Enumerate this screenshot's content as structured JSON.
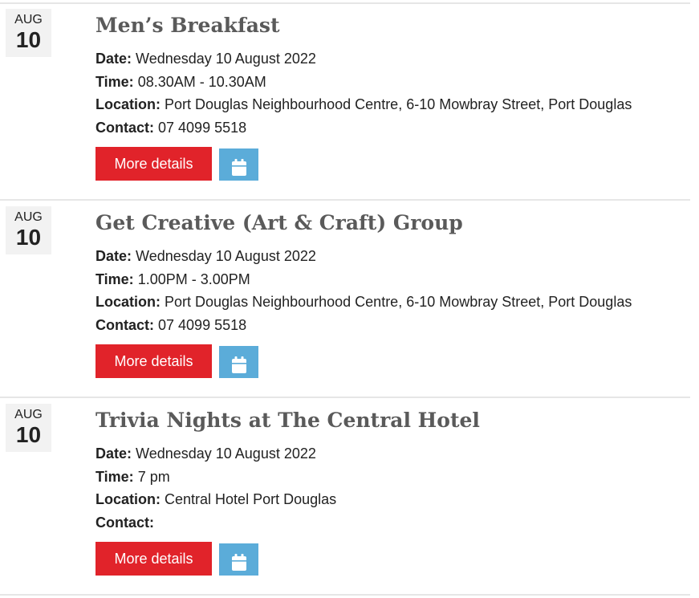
{
  "events": [
    {
      "month": "AUG",
      "day": "10",
      "title": "Men’s Breakfast",
      "date_label": "Date:",
      "date": "Wednesday 10 August 2022",
      "time_label": "Time:",
      "time": "08.30AM - 10.30AM",
      "location_label": "Location:",
      "location": "Port Douglas Neighbourhood Centre, 6-10 Mowbray Street, Port Douglas",
      "contact_label": "Contact:",
      "contact": "07 4099 5518",
      "more_label": "More details",
      "calendar_icon": "calendar-icon"
    },
    {
      "month": "AUG",
      "day": "10",
      "title": "Get Creative (Art & Craft) Group",
      "date_label": "Date:",
      "date": "Wednesday 10 August 2022",
      "time_label": "Time:",
      "time": "1.00PM - 3.00PM",
      "location_label": "Location:",
      "location": "Port Douglas Neighbourhood Centre, 6-10 Mowbray Street, Port Douglas",
      "contact_label": "Contact:",
      "contact": "07 4099 5518",
      "more_label": "More details",
      "calendar_icon": "calendar-icon"
    },
    {
      "month": "AUG",
      "day": "10",
      "title": "Trivia Nights at The Central Hotel",
      "date_label": "Date:",
      "date": "Wednesday 10 August 2022",
      "time_label": "Time:",
      "time": "7 pm",
      "location_label": "Location:",
      "location": "Central Hotel Port Douglas",
      "contact_label": "Contact:",
      "contact": "",
      "more_label": "More details",
      "calendar_icon": "calendar-icon"
    }
  ],
  "colors": {
    "primary_button": "#e1232a",
    "calendar_button": "#5bacd9",
    "title": "#5a5a5a",
    "badge": "#f2f2f2",
    "divider": "#e6e6e6"
  }
}
